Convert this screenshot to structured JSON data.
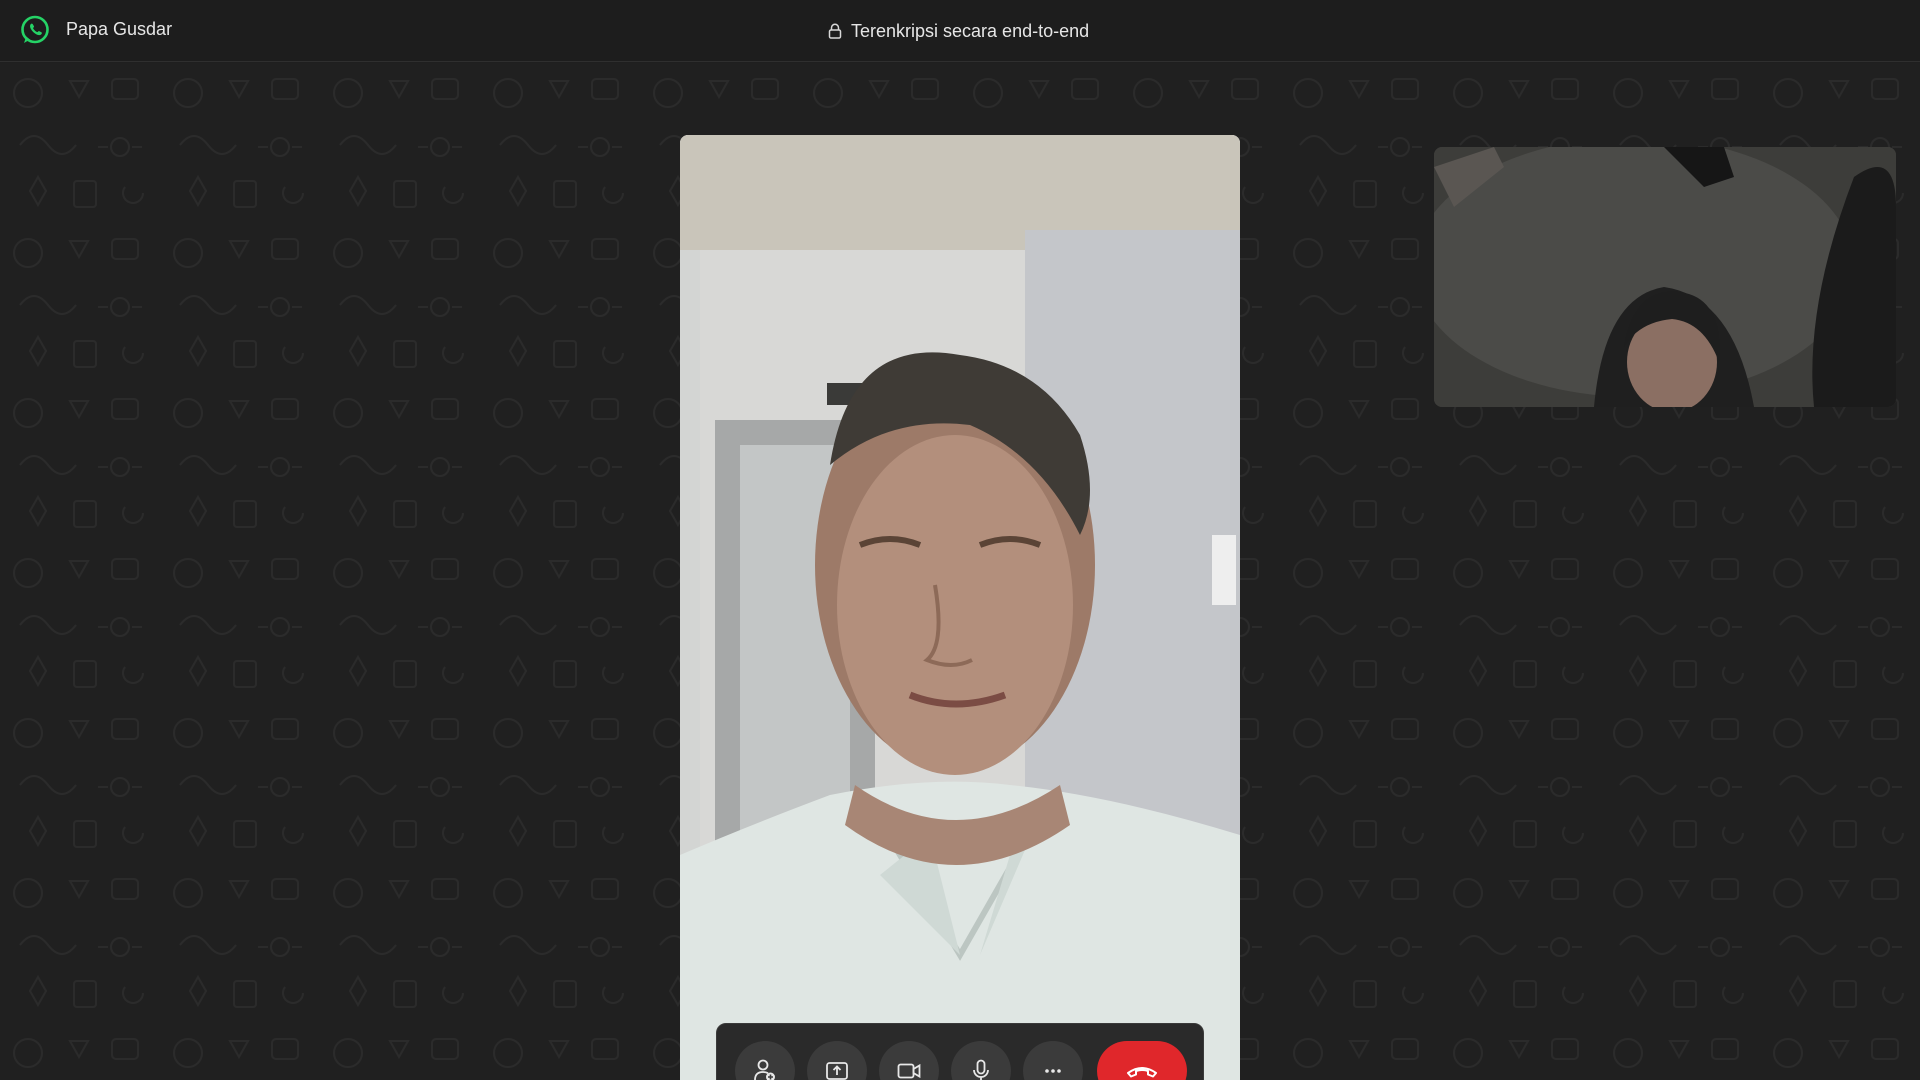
{
  "window": {
    "app_icon": "whatsapp-logo-icon",
    "contact_name": "Papa Gusdar",
    "encryption_text": "Terenkripsi secara end-to-end",
    "encryption_icon": "lock-icon"
  },
  "call": {
    "remote_video": "remote-participant-video",
    "self_view": "self-camera-preview"
  },
  "controls": [
    {
      "name": "add-participant-button",
      "icon": "add-person-icon"
    },
    {
      "name": "share-screen-button",
      "icon": "screen-share-icon"
    },
    {
      "name": "video-toggle-button",
      "icon": "video-camera-icon"
    },
    {
      "name": "mute-button",
      "icon": "microphone-icon"
    },
    {
      "name": "more-options-button",
      "icon": "more-horizontal-icon"
    },
    {
      "name": "end-call-button",
      "icon": "phone-hangup-icon"
    }
  ],
  "colors": {
    "accent_green": "#25d366",
    "end_call_red": "#e0272b",
    "background": "#202020"
  }
}
